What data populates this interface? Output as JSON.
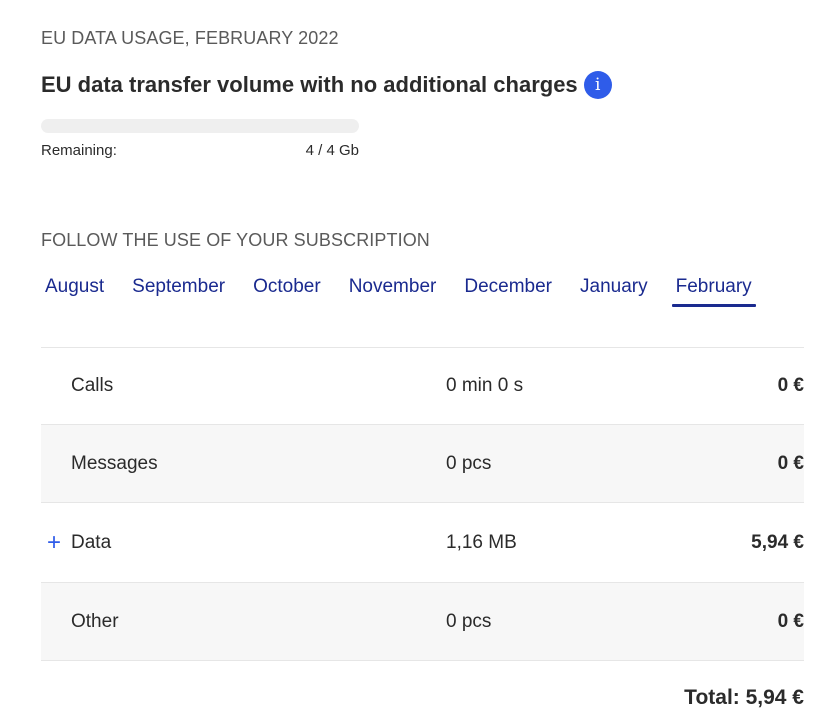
{
  "eu_data": {
    "caption": "EU DATA USAGE, FEBRUARY 2022",
    "title": "EU data transfer volume with no additional charges",
    "info_icon_glyph": "i",
    "info_icon_name": "info-icon",
    "used_fraction": 0,
    "remaining_label": "Remaining:",
    "remaining_value": "4 / 4 Gb"
  },
  "subscription": {
    "caption": "FOLLOW THE USE OF YOUR SUBSCRIPTION",
    "tabs": [
      {
        "label": "August",
        "active": false
      },
      {
        "label": "September",
        "active": false
      },
      {
        "label": "October",
        "active": false
      },
      {
        "label": "November",
        "active": false
      },
      {
        "label": "December",
        "active": false
      },
      {
        "label": "January",
        "active": false
      },
      {
        "label": "February",
        "active": true
      }
    ],
    "rows": [
      {
        "name": "Calls",
        "amount": "0 min 0 s",
        "cost": "0 €",
        "expandable": false
      },
      {
        "name": "Messages",
        "amount": "0 pcs",
        "cost": "0 €",
        "expandable": false
      },
      {
        "name": "Data",
        "amount": "1,16 MB",
        "cost": "5,94 €",
        "expandable": true,
        "expand_glyph": "+"
      },
      {
        "name": "Other",
        "amount": "0 pcs",
        "cost": "0 €",
        "expandable": false
      }
    ],
    "total": "Total: 5,94 €"
  },
  "colors": {
    "accent": "#2f5ce9",
    "tab_text": "#1a2a8f",
    "row_shade": "#f7f7f7"
  }
}
